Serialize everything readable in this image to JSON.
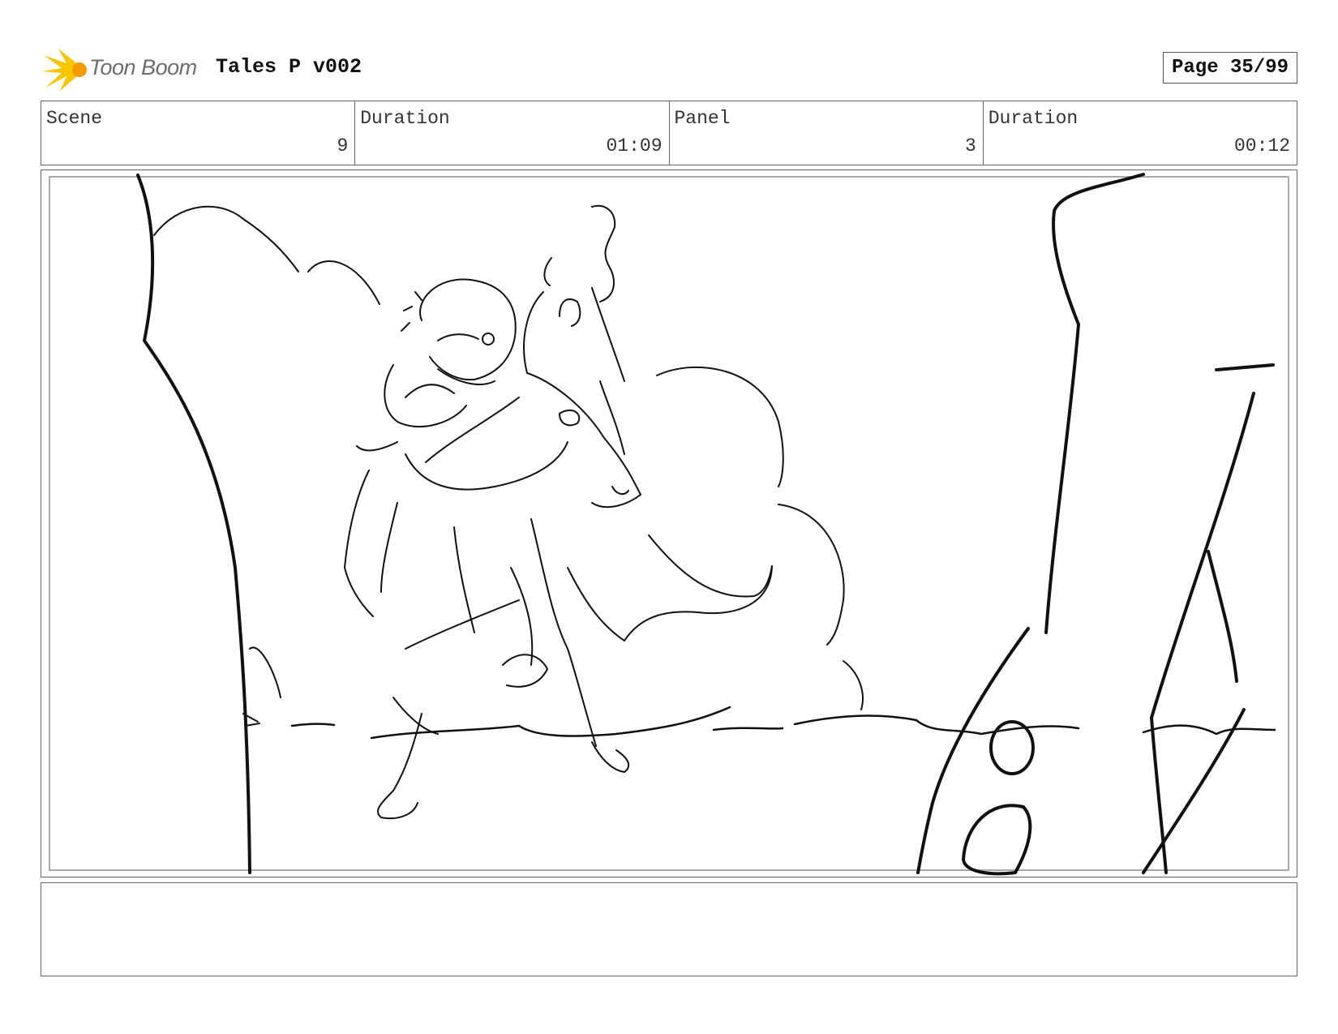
{
  "header": {
    "logo_text": "Toon Boom",
    "project_title": "Tales P v002",
    "page_label": "Page 35/99"
  },
  "info": {
    "scene_label": "Scene",
    "scene_value": "9",
    "scene_duration_label": "Duration",
    "scene_duration_value": "01:09",
    "panel_label": "Panel",
    "panel_value": "3",
    "panel_duration_label": "Duration",
    "panel_duration_value": "00:12"
  },
  "notes": {
    "text": ""
  },
  "colors": {
    "logo_yellow": "#f7c600",
    "logo_orange": "#f29a00",
    "frame_border": "#666666",
    "sketch_line": "#111111"
  }
}
